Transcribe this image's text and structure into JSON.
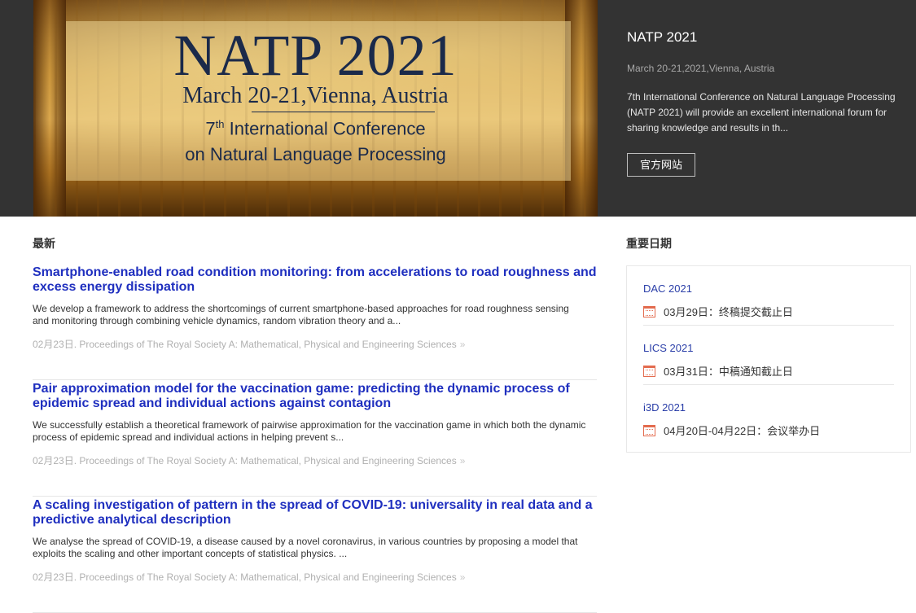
{
  "hero": {
    "banner": {
      "title": "NATP 2021",
      "date": "March 20-21,Vienna, Austria",
      "line1_pre": "7",
      "line1_sup": "th",
      "line1_post": " International Conference",
      "line2": "on Natural Language Processing"
    },
    "name": "NATP 2021",
    "date": "March 20-21,2021,Vienna, Austria",
    "description": "7th International Conference on Natural Language Processing (NATP 2021) will provide an excellent international forum for sharing knowledge and results in th...",
    "button_label": "官方网站"
  },
  "latest": {
    "heading": "最新",
    "items": [
      {
        "title": "Smartphone-enabled road condition monitoring: from accelerations to road roughness and excess energy dissipation",
        "summary": "We develop a framework to address the shortcomings of current smartphone-based approaches for road roughness sensing and monitoring through combining vehicle dynamics, random vibration theory and a...",
        "meta": "02月23日. Proceedings of The Royal Society A: Mathematical, Physical and Engineering Sciences",
        "arrow": "»"
      },
      {
        "title": "Pair approximation model for the vaccination game: predicting the dynamic process of epidemic spread and individual actions against contagion",
        "summary": "We successfully establish a theoretical framework of pairwise approximation for the vaccination game in which both the dynamic process of epidemic spread and individual actions in helping prevent s...",
        "meta": "02月23日. Proceedings of The Royal Society A: Mathematical, Physical and Engineering Sciences",
        "arrow": "»"
      },
      {
        "title": "A scaling investigation of pattern in the spread of COVID-19: universality in real data and a predictive analytical description",
        "summary": "We analyse the spread of COVID-19, a disease caused by a novel coronavirus, in various countries by proposing a model that exploits the scaling and other important concepts of statistical physics. ...",
        "meta": "02月23日. Proceedings of The Royal Society A: Mathematical, Physical and Engineering Sciences",
        "arrow": "»"
      }
    ]
  },
  "important_dates": {
    "heading": "重要日期",
    "items": [
      {
        "conference": "DAC 2021",
        "date_text": "03月29日：终稿提交截止日"
      },
      {
        "conference": "LICS 2021",
        "date_text": "03月31日：中稿通知截止日"
      },
      {
        "conference": "i3D 2021",
        "date_text": "04月20日-04月22日：会议举办日"
      }
    ]
  },
  "colors": {
    "hero_bg": "#333333",
    "link_blue": "#1f2fbf",
    "calendar_icon": "#e36b4e"
  }
}
